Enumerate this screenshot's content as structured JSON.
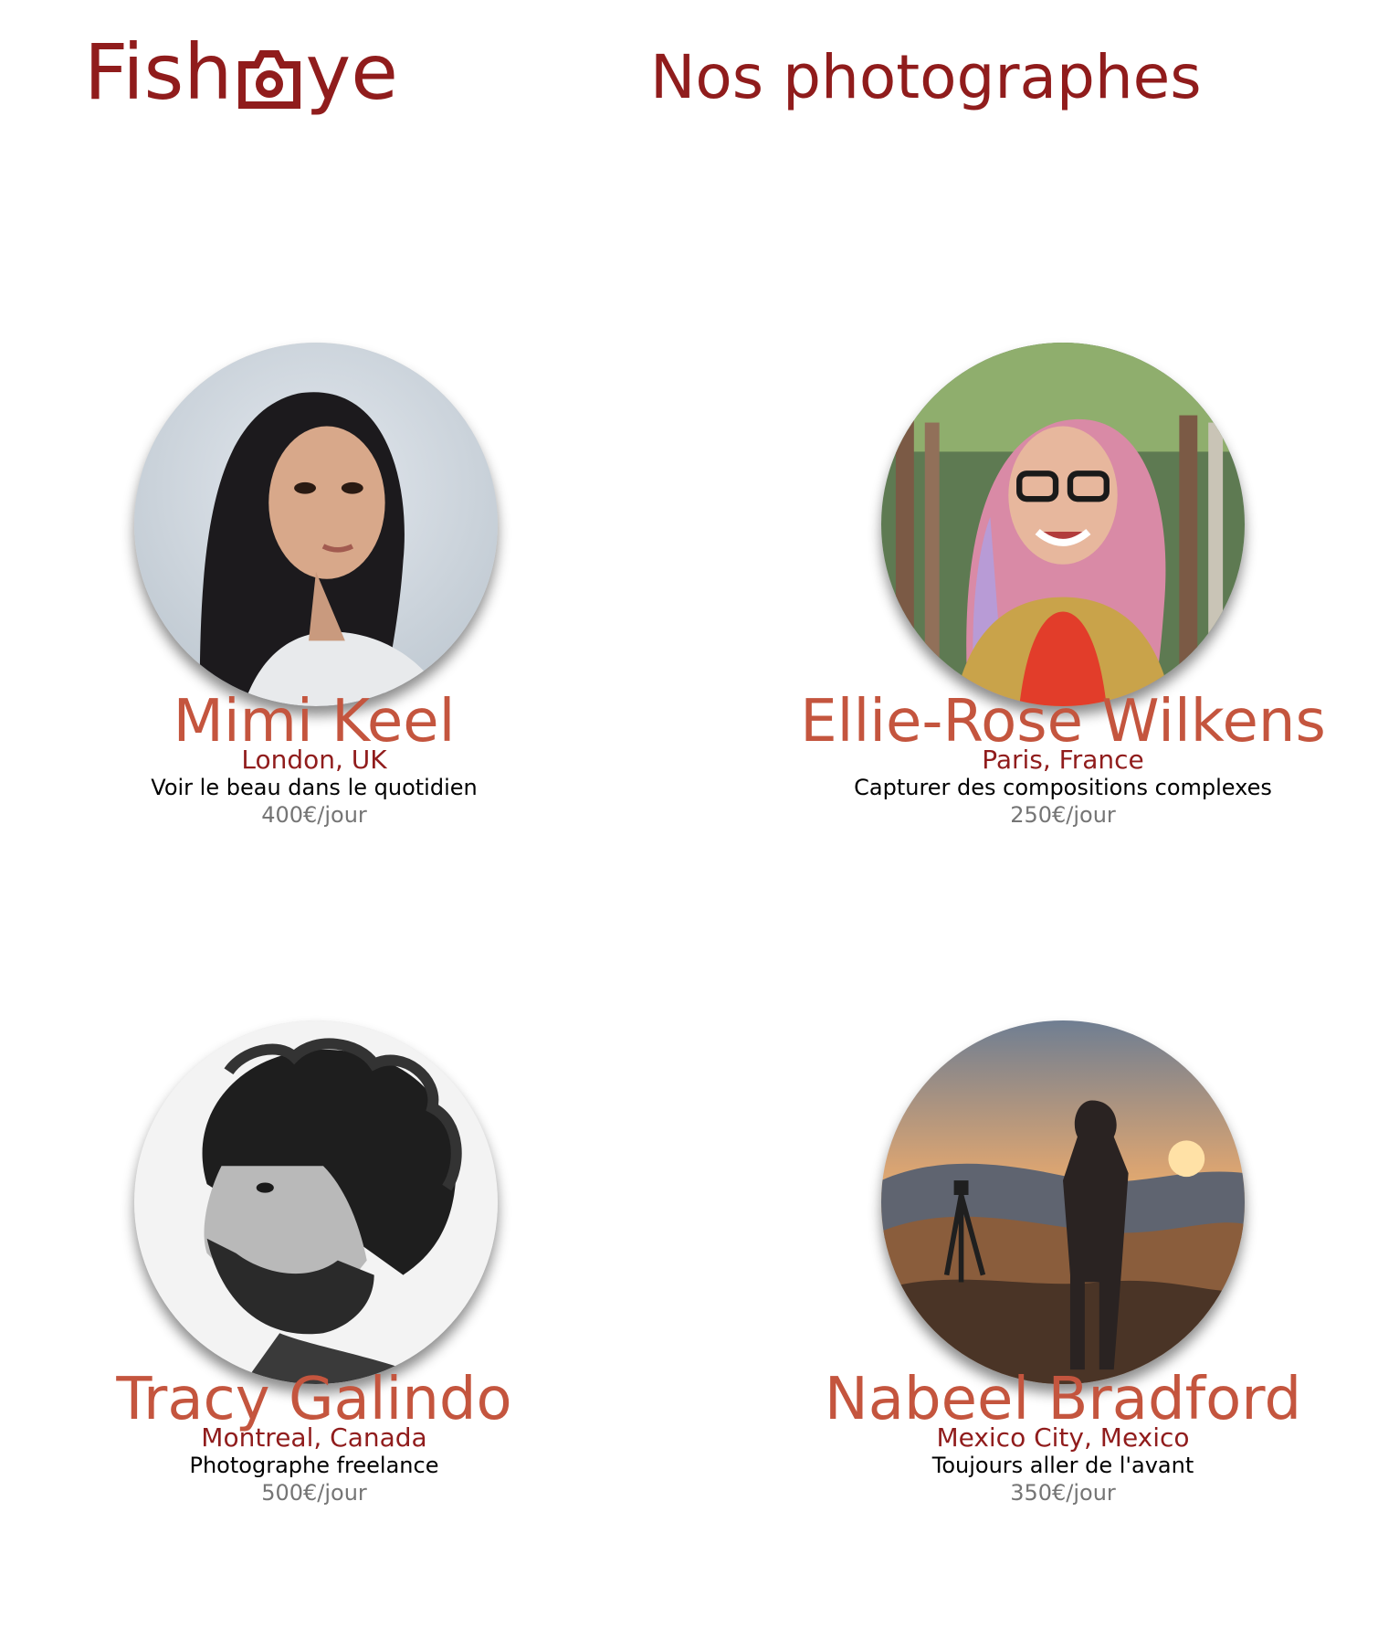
{
  "header": {
    "logo_text_before": "Fish",
    "logo_icon": "camera-icon",
    "logo_text_after": "ye",
    "title": "Nos photographes"
  },
  "colors": {
    "brand": "#901C1C",
    "name": "#C4553E",
    "price": "#757575",
    "text": "#000000"
  },
  "photographers": [
    {
      "name": "Mimi Keel",
      "location": "London, UK",
      "tagline": "Voir le beau dans le quotidien",
      "price": "400€/jour",
      "portrait_icon": "portrait-mimi-keel"
    },
    {
      "name": "Ellie-Rose Wilkens",
      "location": "Paris, France",
      "tagline": "Capturer des compositions complexes",
      "price": "250€/jour",
      "portrait_icon": "portrait-ellie-rose-wilkens"
    },
    {
      "name": "Tracy Galindo",
      "location": "Montreal, Canada",
      "tagline": "Photographe freelance",
      "price": "500€/jour",
      "portrait_icon": "portrait-tracy-galindo"
    },
    {
      "name": "Nabeel Bradford",
      "location": "Mexico City, Mexico",
      "tagline": "Toujours aller de l'avant",
      "price": "350€/jour",
      "portrait_icon": "portrait-nabeel-bradford"
    }
  ]
}
